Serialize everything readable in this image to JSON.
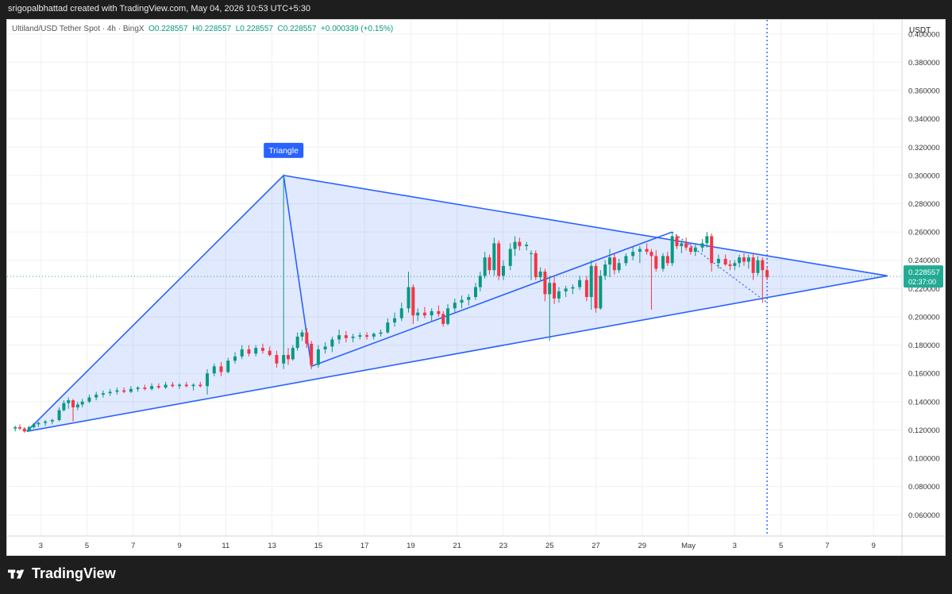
{
  "header": {
    "caption": "srigopalbhattad created with TradingView.com, May 04, 2026 10:53 UTC+5:30"
  },
  "legend": {
    "symbol": "Ultiland/USD Tether Spot · 4h · BingX",
    "o": "O0.228557",
    "h": "H0.228557",
    "l": "L0.228557",
    "c": "C0.228557",
    "change": "+0.000339 (+0.15%)"
  },
  "axis": {
    "currency": "USDT"
  },
  "price_tag": {
    "price": "0.228557",
    "countdown": "02:37:00",
    "color": "#22ab94"
  },
  "footer": {
    "brand": "TradingView"
  },
  "colors": {
    "up": "#089981",
    "down": "#f23645",
    "pattern": "#2962ff",
    "fill": "#2962ff22",
    "label_bg": "#2962ff"
  },
  "chart_data": {
    "type": "candlestick",
    "title": "Ultiland/USD Tether Spot · 4h · BingX",
    "ylabel": "USDT",
    "ylim": [
      0.045,
      0.41
    ],
    "y_ticks": [
      "0.060000",
      "0.080000",
      "0.100000",
      "0.120000",
      "0.140000",
      "0.160000",
      "0.180000",
      "0.200000",
      "0.220000",
      "0.240000",
      "0.260000",
      "0.280000",
      "0.300000",
      "0.320000",
      "0.340000",
      "0.360000",
      "0.380000",
      "0.400000"
    ],
    "x_range": [
      1.8,
      10.9
    ],
    "x_ticks": [
      {
        "label": "3",
        "pos": 3
      },
      {
        "label": "5",
        "pos": 5
      },
      {
        "label": "7",
        "pos": 7
      },
      {
        "label": "9",
        "pos": 9
      },
      {
        "label": "11",
        "pos": 11
      },
      {
        "label": "13",
        "pos": 13
      },
      {
        "label": "15",
        "pos": 15
      },
      {
        "label": "17",
        "pos": 17
      },
      {
        "label": "19",
        "pos": 19
      },
      {
        "label": "21",
        "pos": 21
      },
      {
        "label": "23",
        "pos": 23
      },
      {
        "label": "25",
        "pos": 25
      },
      {
        "label": "27",
        "pos": 27
      },
      {
        "label": "29",
        "pos": 29
      },
      {
        "label": "May",
        "pos": 31
      },
      {
        "label": "3",
        "pos": 33
      },
      {
        "label": "5",
        "pos": 35
      },
      {
        "label": "7",
        "pos": 37
      },
      {
        "label": "9",
        "pos": 39
      }
    ],
    "grid": true,
    "current_price": 0.228557,
    "pattern": {
      "label": "Triangle",
      "points": [
        [
          2.4,
          0.119
        ],
        [
          13.5,
          0.3
        ],
        [
          14.7,
          0.165
        ],
        [
          30.3,
          0.26
        ],
        [
          39.6,
          0.229
        ]
      ],
      "lower_line": [
        [
          2.4,
          0.119
        ],
        [
          39.6,
          0.229
        ]
      ],
      "upper_line": [
        [
          13.5,
          0.3
        ],
        [
          39.6,
          0.229
        ]
      ]
    },
    "dotted_projection": [
      [
        30.3,
        0.26
      ],
      [
        34.4,
        0.21
      ]
    ],
    "now_marker_x": 34.4,
    "candles": [
      [
        1.9,
        0.121,
        0.123,
        0.119,
        0.122
      ],
      [
        2.1,
        0.122,
        0.124,
        0.12,
        0.121
      ],
      [
        2.3,
        0.121,
        0.122,
        0.118,
        0.119
      ],
      [
        2.5,
        0.119,
        0.123,
        0.119,
        0.122
      ],
      [
        2.7,
        0.122,
        0.125,
        0.121,
        0.124
      ],
      [
        2.9,
        0.124,
        0.126,
        0.122,
        0.125
      ],
      [
        3.2,
        0.125,
        0.127,
        0.123,
        0.126
      ],
      [
        3.5,
        0.126,
        0.128,
        0.124,
        0.127
      ],
      [
        3.8,
        0.127,
        0.136,
        0.126,
        0.134
      ],
      [
        4.0,
        0.134,
        0.141,
        0.133,
        0.139
      ],
      [
        4.2,
        0.139,
        0.143,
        0.135,
        0.141
      ],
      [
        4.4,
        0.141,
        0.142,
        0.126,
        0.136
      ],
      [
        4.6,
        0.136,
        0.14,
        0.134,
        0.138
      ],
      [
        4.8,
        0.138,
        0.142,
        0.136,
        0.14
      ],
      [
        5.1,
        0.14,
        0.145,
        0.139,
        0.143
      ],
      [
        5.4,
        0.143,
        0.147,
        0.141,
        0.145
      ],
      [
        5.7,
        0.145,
        0.148,
        0.143,
        0.146
      ],
      [
        6.0,
        0.146,
        0.149,
        0.144,
        0.147
      ],
      [
        6.3,
        0.147,
        0.15,
        0.145,
        0.148
      ],
      [
        6.6,
        0.148,
        0.15,
        0.146,
        0.147
      ],
      [
        6.9,
        0.147,
        0.151,
        0.146,
        0.149
      ],
      [
        7.2,
        0.149,
        0.151,
        0.147,
        0.15
      ],
      [
        7.5,
        0.15,
        0.152,
        0.148,
        0.149
      ],
      [
        7.8,
        0.149,
        0.153,
        0.148,
        0.151
      ],
      [
        8.1,
        0.151,
        0.153,
        0.149,
        0.15
      ],
      [
        8.4,
        0.15,
        0.154,
        0.149,
        0.152
      ],
      [
        8.7,
        0.152,
        0.154,
        0.15,
        0.151
      ],
      [
        9.0,
        0.151,
        0.153,
        0.149,
        0.152
      ],
      [
        9.3,
        0.152,
        0.154,
        0.15,
        0.151
      ],
      [
        9.6,
        0.151,
        0.153,
        0.148,
        0.152
      ],
      [
        9.9,
        0.152,
        0.154,
        0.15,
        0.151
      ],
      [
        10.2,
        0.151,
        0.163,
        0.145,
        0.16
      ],
      [
        10.5,
        0.16,
        0.167,
        0.158,
        0.165
      ],
      [
        10.8,
        0.165,
        0.168,
        0.158,
        0.161
      ],
      [
        11.1,
        0.161,
        0.171,
        0.16,
        0.169
      ],
      [
        11.4,
        0.169,
        0.175,
        0.167,
        0.172
      ],
      [
        11.7,
        0.172,
        0.18,
        0.17,
        0.177
      ],
      [
        12.0,
        0.177,
        0.18,
        0.172,
        0.174
      ],
      [
        12.3,
        0.174,
        0.18,
        0.172,
        0.178
      ],
      [
        12.6,
        0.178,
        0.181,
        0.174,
        0.176
      ],
      [
        12.9,
        0.176,
        0.179,
        0.172,
        0.173
      ],
      [
        13.2,
        0.173,
        0.176,
        0.164,
        0.167
      ],
      [
        13.5,
        0.167,
        0.3,
        0.163,
        0.173
      ],
      [
        13.7,
        0.173,
        0.178,
        0.166,
        0.17
      ],
      [
        13.9,
        0.17,
        0.18,
        0.169,
        0.178
      ],
      [
        14.1,
        0.178,
        0.189,
        0.176,
        0.186
      ],
      [
        14.3,
        0.186,
        0.191,
        0.183,
        0.189
      ],
      [
        14.5,
        0.189,
        0.192,
        0.178,
        0.181
      ],
      [
        14.7,
        0.181,
        0.183,
        0.163,
        0.166
      ],
      [
        15.0,
        0.166,
        0.18,
        0.164,
        0.177
      ],
      [
        15.3,
        0.177,
        0.182,
        0.174,
        0.179
      ],
      [
        15.6,
        0.179,
        0.186,
        0.175,
        0.184
      ],
      [
        15.9,
        0.184,
        0.191,
        0.181,
        0.187
      ],
      [
        16.2,
        0.187,
        0.19,
        0.182,
        0.185
      ],
      [
        16.5,
        0.185,
        0.188,
        0.182,
        0.186
      ],
      [
        16.8,
        0.186,
        0.189,
        0.184,
        0.187
      ],
      [
        17.1,
        0.187,
        0.189,
        0.184,
        0.186
      ],
      [
        17.4,
        0.186,
        0.189,
        0.184,
        0.188
      ],
      [
        17.7,
        0.188,
        0.191,
        0.186,
        0.189
      ],
      [
        18.0,
        0.189,
        0.199,
        0.188,
        0.196
      ],
      [
        18.3,
        0.196,
        0.203,
        0.193,
        0.199
      ],
      [
        18.6,
        0.199,
        0.21,
        0.197,
        0.206
      ],
      [
        18.9,
        0.206,
        0.232,
        0.203,
        0.221
      ],
      [
        19.1,
        0.221,
        0.223,
        0.195,
        0.201
      ],
      [
        19.3,
        0.201,
        0.206,
        0.197,
        0.203
      ],
      [
        19.6,
        0.203,
        0.207,
        0.199,
        0.201
      ],
      [
        19.9,
        0.201,
        0.206,
        0.197,
        0.204
      ],
      [
        20.2,
        0.204,
        0.208,
        0.2,
        0.202
      ],
      [
        20.4,
        0.202,
        0.204,
        0.193,
        0.195
      ],
      [
        20.6,
        0.195,
        0.209,
        0.194,
        0.206
      ],
      [
        20.9,
        0.206,
        0.213,
        0.203,
        0.21
      ],
      [
        21.2,
        0.21,
        0.215,
        0.206,
        0.212
      ],
      [
        21.5,
        0.212,
        0.216,
        0.208,
        0.214
      ],
      [
        21.8,
        0.214,
        0.224,
        0.212,
        0.221
      ],
      [
        22.0,
        0.221,
        0.232,
        0.218,
        0.229
      ],
      [
        22.2,
        0.229,
        0.246,
        0.227,
        0.242
      ],
      [
        22.4,
        0.242,
        0.244,
        0.23,
        0.233
      ],
      [
        22.6,
        0.233,
        0.256,
        0.229,
        0.252
      ],
      [
        22.8,
        0.252,
        0.254,
        0.226,
        0.229
      ],
      [
        23.0,
        0.229,
        0.24,
        0.226,
        0.236
      ],
      [
        23.3,
        0.236,
        0.252,
        0.233,
        0.248
      ],
      [
        23.5,
        0.248,
        0.257,
        0.243,
        0.253
      ],
      [
        23.7,
        0.253,
        0.256,
        0.247,
        0.25
      ],
      [
        24.0,
        0.25,
        0.253,
        0.247,
        0.251
      ],
      [
        24.2,
        0.245,
        0.247,
        0.226,
        0.245
      ],
      [
        24.4,
        0.245,
        0.247,
        0.226,
        0.228
      ],
      [
        24.6,
        0.228,
        0.235,
        0.225,
        0.232
      ],
      [
        24.8,
        0.232,
        0.234,
        0.211,
        0.216
      ],
      [
        25.0,
        0.216,
        0.229,
        0.183,
        0.224
      ],
      [
        25.2,
        0.224,
        0.229,
        0.209,
        0.213
      ],
      [
        25.4,
        0.213,
        0.221,
        0.21,
        0.218
      ],
      [
        25.7,
        0.218,
        0.222,
        0.214,
        0.22
      ],
      [
        26.0,
        0.22,
        0.223,
        0.216,
        0.221
      ],
      [
        26.3,
        0.221,
        0.229,
        0.219,
        0.226
      ],
      [
        26.6,
        0.226,
        0.229,
        0.211,
        0.214
      ],
      [
        26.8,
        0.214,
        0.24,
        0.205,
        0.236
      ],
      [
        27.0,
        0.236,
        0.238,
        0.203,
        0.206
      ],
      [
        27.2,
        0.206,
        0.233,
        0.205,
        0.229
      ],
      [
        27.4,
        0.229,
        0.24,
        0.226,
        0.237
      ],
      [
        27.6,
        0.237,
        0.248,
        0.228,
        0.242
      ],
      [
        27.8,
        0.242,
        0.245,
        0.23,
        0.233
      ],
      [
        28.0,
        0.233,
        0.241,
        0.231,
        0.238
      ],
      [
        28.3,
        0.238,
        0.245,
        0.236,
        0.243
      ],
      [
        28.6,
        0.243,
        0.25,
        0.24,
        0.246
      ],
      [
        28.9,
        0.246,
        0.25,
        0.238,
        0.248
      ],
      [
        29.2,
        0.248,
        0.252,
        0.244,
        0.246
      ],
      [
        29.4,
        0.246,
        0.248,
        0.205,
        0.243
      ],
      [
        29.6,
        0.243,
        0.247,
        0.232,
        0.234
      ],
      [
        29.9,
        0.234,
        0.245,
        0.232,
        0.243
      ],
      [
        30.1,
        0.243,
        0.246,
        0.236,
        0.238
      ],
      [
        30.3,
        0.238,
        0.26,
        0.236,
        0.257
      ],
      [
        30.5,
        0.257,
        0.258,
        0.248,
        0.25
      ],
      [
        30.7,
        0.25,
        0.254,
        0.245,
        0.252
      ],
      [
        30.9,
        0.252,
        0.256,
        0.247,
        0.249
      ],
      [
        31.1,
        0.249,
        0.252,
        0.244,
        0.246
      ],
      [
        31.3,
        0.246,
        0.251,
        0.243,
        0.249
      ],
      [
        31.6,
        0.249,
        0.255,
        0.246,
        0.252
      ],
      [
        31.8,
        0.252,
        0.26,
        0.249,
        0.257
      ],
      [
        32.0,
        0.257,
        0.259,
        0.232,
        0.238
      ],
      [
        32.3,
        0.238,
        0.244,
        0.234,
        0.241
      ],
      [
        32.6,
        0.241,
        0.244,
        0.236,
        0.237
      ],
      [
        32.8,
        0.237,
        0.24,
        0.233,
        0.236
      ],
      [
        33.0,
        0.236,
        0.24,
        0.233,
        0.238
      ],
      [
        33.2,
        0.238,
        0.244,
        0.235,
        0.242
      ],
      [
        33.4,
        0.242,
        0.245,
        0.236,
        0.239
      ],
      [
        33.6,
        0.239,
        0.244,
        0.234,
        0.242
      ],
      [
        33.8,
        0.242,
        0.245,
        0.226,
        0.231
      ],
      [
        34.0,
        0.231,
        0.243,
        0.229,
        0.24
      ],
      [
        34.2,
        0.24,
        0.242,
        0.21,
        0.233
      ],
      [
        34.4,
        0.233,
        0.235,
        0.226,
        0.228
      ]
    ]
  }
}
